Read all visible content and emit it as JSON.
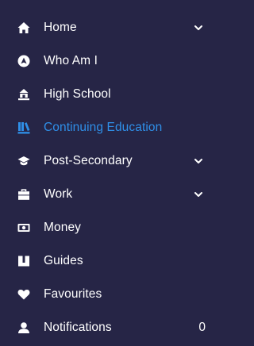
{
  "colors": {
    "background": "#262546",
    "text": "#ffffff",
    "active": "#2f8fe8"
  },
  "nav": {
    "items": [
      {
        "label": "Home",
        "icon": "home-icon",
        "chevron": true
      },
      {
        "label": "Who Am I",
        "icon": "compass-icon"
      },
      {
        "label": "High School",
        "icon": "school-icon"
      },
      {
        "label": "Continuing Education",
        "icon": "books-icon",
        "active": true
      },
      {
        "label": "Post-Secondary",
        "icon": "graduation-cap-icon",
        "chevron": true
      },
      {
        "label": "Work",
        "icon": "briefcase-icon",
        "chevron": true
      },
      {
        "label": "Money",
        "icon": "money-icon"
      },
      {
        "label": "Guides",
        "icon": "book-icon"
      },
      {
        "label": "Favourites",
        "icon": "heart-icon"
      },
      {
        "label": "Notifications",
        "icon": "bell-icon",
        "count": "0"
      }
    ]
  }
}
